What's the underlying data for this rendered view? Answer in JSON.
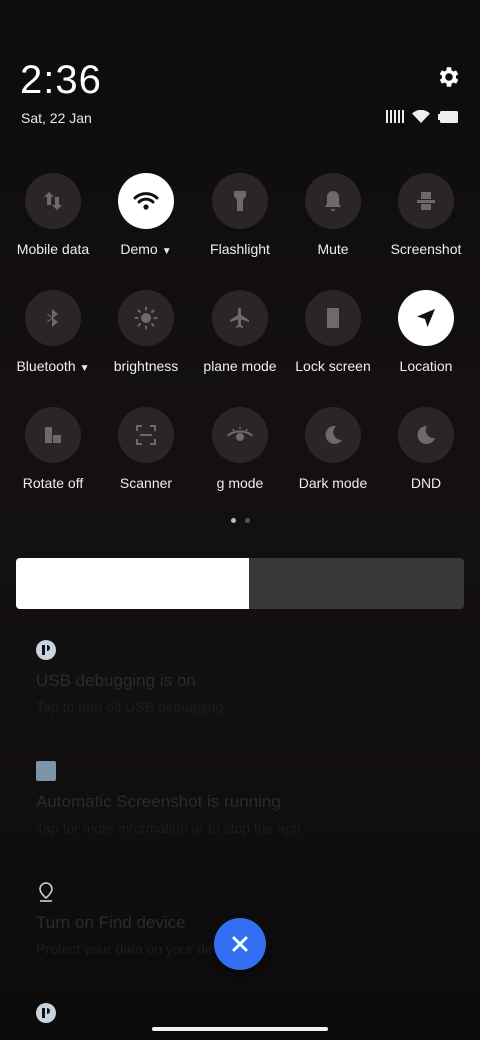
{
  "status_bar": {
    "time": "2:36",
    "date": "Sat, 22 Jan",
    "icons": [
      "signal-icon",
      "wifi-icon",
      "battery-icon"
    ]
  },
  "quick_settings": {
    "row1": [
      {
        "label": "Mobile data",
        "icon": "mobile-data-icon",
        "active": false
      },
      {
        "label": "Demo",
        "icon": "wifi-icon",
        "active": true,
        "has_dropdown": true
      },
      {
        "label": "Flashlight",
        "icon": "flashlight-icon",
        "active": false
      },
      {
        "label": "Mute",
        "icon": "bell-icon",
        "active": false
      },
      {
        "label": "Screenshot",
        "icon": "screenshot-icon",
        "active": false
      }
    ],
    "row2": [
      {
        "label": "Bluetooth",
        "icon": "bluetooth-icon",
        "active": false,
        "has_dropdown": true
      },
      {
        "label": "brightness",
        "icon": "brightness-icon",
        "active": false
      },
      {
        "label": "plane mode",
        "icon": "airplane-icon",
        "active": false
      },
      {
        "label": "Lock screen",
        "icon": "lock-screen-icon",
        "active": false
      },
      {
        "label": "Location",
        "icon": "location-icon",
        "active": true
      }
    ],
    "row3": [
      {
        "label": "Rotate off",
        "icon": "rotate-icon",
        "active": false
      },
      {
        "label": "Scanner",
        "icon": "scanner-icon",
        "active": false
      },
      {
        "label": "g mode",
        "icon": "eye-icon",
        "active": false
      },
      {
        "label": "Dark mode",
        "icon": "dark-mode-icon",
        "active": false
      },
      {
        "label": "DND",
        "icon": "moon-icon",
        "active": false
      }
    ],
    "page_count": 2,
    "active_page": 1
  },
  "brightness_slider": {
    "value_fraction": 0.52
  },
  "notifications": [
    {
      "title": "USB debugging is on",
      "subtitle": "Tap to turn off USB debugging",
      "icon": "android-settings-icon"
    },
    {
      "title": "Automatic Screenshot is running",
      "subtitle": "Tap for more information or to stop the app",
      "icon": "app-square-icon"
    },
    {
      "title": "Turn on Find device",
      "subtitle": "Protect your data on your device",
      "icon": "location-pin-icon"
    }
  ],
  "colors": {
    "accent": "#2f6ff0",
    "tile_bg": "#2a2627",
    "tile_active": "#ffffff"
  }
}
